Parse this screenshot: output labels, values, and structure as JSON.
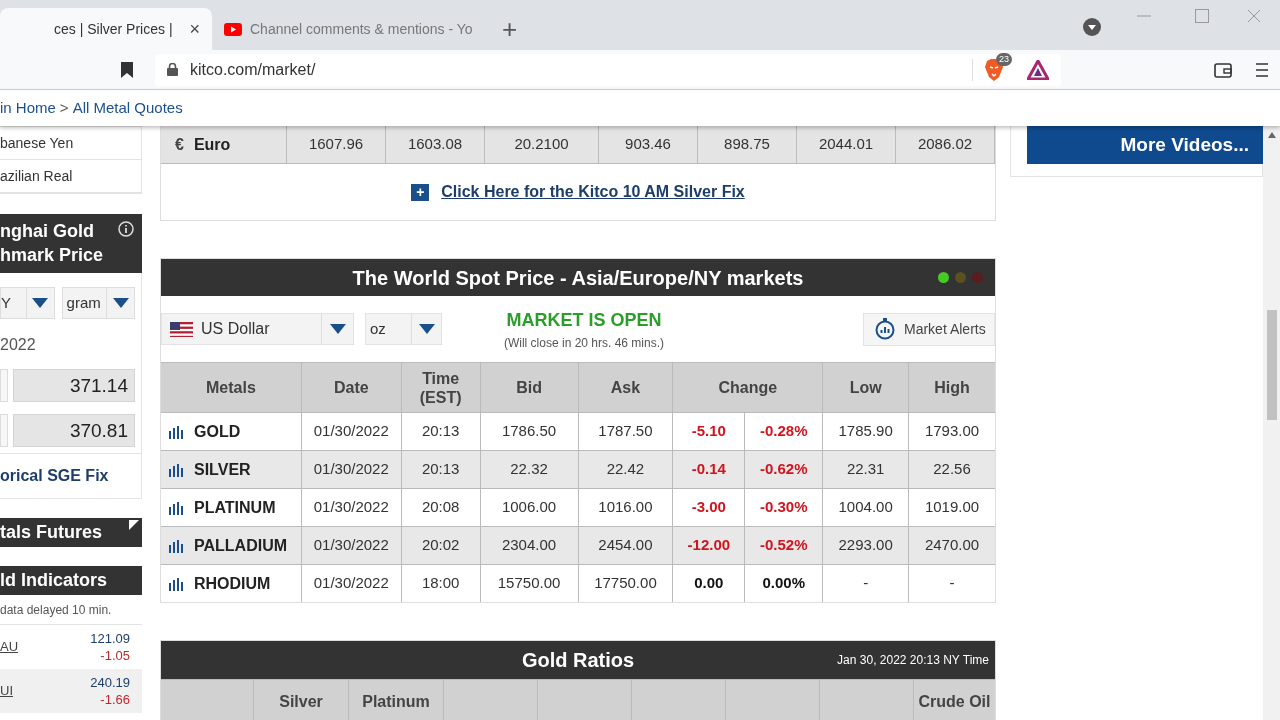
{
  "browser": {
    "tabs": [
      {
        "title": "ces | Silver Prices |",
        "selected": true,
        "close": "×"
      },
      {
        "title": "Channel comments & mentions - Yo",
        "selected": false
      }
    ],
    "new_tab": "+",
    "url": "kitco.com/market/",
    "shield_badge": "23"
  },
  "breadcrumb": {
    "parent": "in Home",
    "separator": ">",
    "current": "All Metal Quotes"
  },
  "sidebar": {
    "currency_items": [
      "banese Yen",
      "azilian Real"
    ],
    "sge": {
      "title_lines": [
        "nghai Gold",
        "hmark Price"
      ],
      "currency": "Y",
      "unit": "gram",
      "date": "2022",
      "values": [
        "371.14",
        "370.81"
      ],
      "link": "orical SGE Fix"
    },
    "futures_title": "tals Futures",
    "indicators": {
      "title": "ld Indicators",
      "note": "data delayed 10 min.",
      "rows": [
        {
          "name": "AU",
          "value": "121.09",
          "change": "-1.05"
        },
        {
          "name": "UI",
          "value": "240.19",
          "change": "-1.66"
        }
      ]
    }
  },
  "euro_row": {
    "symbol": "€",
    "name": "Euro",
    "cells": [
      "1607.96",
      "1603.08",
      "20.2100",
      "903.46",
      "898.75",
      "2044.01",
      "2086.02"
    ]
  },
  "silver_fix_link": {
    "icon": "+",
    "text": "Click Here for the Kitco 10 AM Silver Fix"
  },
  "spot_price": {
    "title": "The World Spot Price - Asia/Europe/NY markets",
    "lights": [
      {
        "color": "#44cc22"
      },
      {
        "color": "#5a5020"
      },
      {
        "color": "#5a1c1c"
      }
    ],
    "currency": "US Dollar",
    "unit": "oz",
    "status": "MARKET IS OPEN",
    "status_note": "(Will close in 20 hrs. 46 mins.)",
    "alerts_button": "Market Alerts",
    "columns": [
      "Metals",
      "Date",
      "Time\n(EST)",
      "Bid",
      "Ask",
      "Change",
      "Low",
      "High"
    ],
    "rows": [
      {
        "metal": "GOLD",
        "date": "01/30/2022",
        "time": "20:13",
        "bid": "1786.50",
        "ask": "1787.50",
        "change": "-5.10",
        "change_pct": "-0.28%",
        "negative": true,
        "low": "1785.90",
        "high": "1793.00"
      },
      {
        "metal": "SILVER",
        "date": "01/30/2022",
        "time": "20:13",
        "bid": "22.32",
        "ask": "22.42",
        "change": "-0.14",
        "change_pct": "-0.62%",
        "negative": true,
        "low": "22.31",
        "high": "22.56"
      },
      {
        "metal": "PLATINUM",
        "date": "01/30/2022",
        "time": "20:08",
        "bid": "1006.00",
        "ask": "1016.00",
        "change": "-3.00",
        "change_pct": "-0.30%",
        "negative": true,
        "low": "1004.00",
        "high": "1019.00"
      },
      {
        "metal": "PALLADIUM",
        "date": "01/30/2022",
        "time": "20:02",
        "bid": "2304.00",
        "ask": "2454.00",
        "change": "-12.00",
        "change_pct": "-0.52%",
        "negative": true,
        "low": "2293.00",
        "high": "2470.00"
      },
      {
        "metal": "RHODIUM",
        "date": "01/30/2022",
        "time": "18:00",
        "bid": "15750.00",
        "ask": "17750.00",
        "change": "0.00",
        "change_pct": "0.00%",
        "negative": false,
        "low": "-",
        "high": "-"
      }
    ]
  },
  "gold_ratios": {
    "title": "Gold Ratios",
    "timestamp": "Jan 30, 2022 20:13 NY Time",
    "columns": [
      "Silver",
      "Platinum",
      "Crude Oil"
    ]
  },
  "more_videos": "More Videos..."
}
